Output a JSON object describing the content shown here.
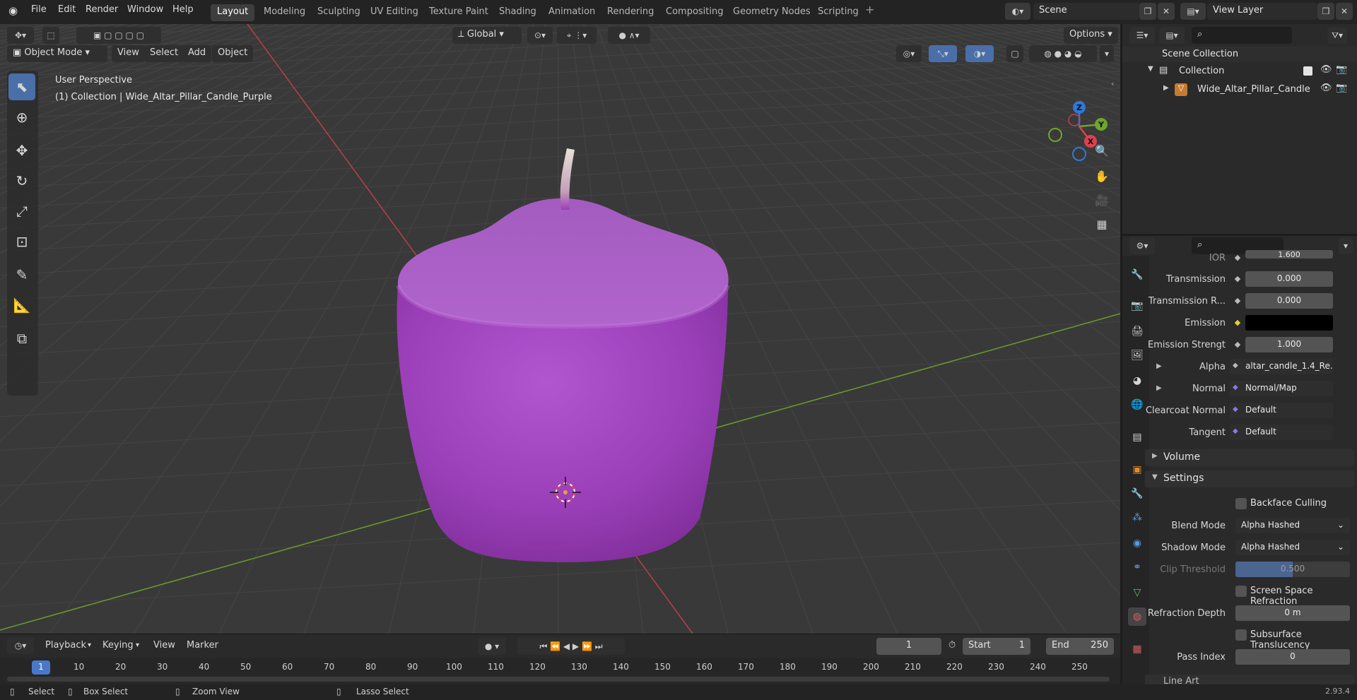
{
  "menu": {
    "items": [
      "File",
      "Edit",
      "Render",
      "Window",
      "Help"
    ]
  },
  "workspaces": {
    "tabs": [
      "Layout",
      "Modeling",
      "Sculpting",
      "UV Editing",
      "Texture Paint",
      "Shading",
      "Animation",
      "Rendering",
      "Compositing",
      "Geometry Nodes",
      "Scripting"
    ],
    "active": "Layout"
  },
  "scene": {
    "name": "Scene",
    "view_layer": "View Layer"
  },
  "viewport_header": {
    "mode": "Object Mode",
    "menus": [
      "View",
      "Select",
      "Add",
      "Object"
    ],
    "transform_orientation": "Global",
    "options_label": "Options"
  },
  "viewport": {
    "perspective_label": "User Perspective",
    "collection_label": "(1) Collection | Wide_Altar_Pillar_Candle_Purple",
    "gizmo_axes": [
      "Z",
      "Y",
      "X"
    ],
    "axis_colors": {
      "x": "#e0404f",
      "y": "#6ea52c",
      "z": "#2f78d8"
    },
    "object_color": "#9a3fb8"
  },
  "outliner": {
    "root": "Scene Collection",
    "collection": "Collection",
    "object": "Wide_Altar_Pillar_Candle"
  },
  "properties": {
    "rows": [
      {
        "label": "IOR",
        "value": "1.600"
      },
      {
        "label": "Transmission",
        "value": "0.000"
      },
      {
        "label": "Transmission R...",
        "value": "0.000"
      },
      {
        "label": "Emission",
        "value": ""
      },
      {
        "label": "Emission Strengt",
        "value": "1.000"
      }
    ],
    "links": [
      {
        "label": "Alpha",
        "value": "altar_candle_1.4_Re..."
      },
      {
        "label": "Normal",
        "value": "Normal/Map"
      },
      {
        "label": "Clearcoat Normal",
        "value": "Default"
      },
      {
        "label": "Tangent",
        "value": "Default"
      }
    ],
    "sections": [
      "Volume",
      "Settings",
      "Line Art"
    ],
    "backface_culling": "Backface Culling",
    "blend_mode": {
      "label": "Blend Mode",
      "value": "Alpha Hashed"
    },
    "shadow_mode": {
      "label": "Shadow Mode",
      "value": "Alpha Hashed"
    },
    "clip_threshold": {
      "label": "Clip Threshold",
      "value": "0.500"
    },
    "screen_space_refraction": "Screen Space Refraction",
    "refraction_depth": {
      "label": "Refraction Depth",
      "value": "0 m"
    },
    "subsurface_translucency": "Subsurface Translucency",
    "pass_index": {
      "label": "Pass Index",
      "value": "0"
    }
  },
  "timeline": {
    "menus": [
      "Playback",
      "Keying",
      "View",
      "Marker"
    ],
    "current_frame": "1",
    "start_label": "Start",
    "start": "1",
    "end_label": "End",
    "end": "250",
    "frame_ticks": [
      "1",
      "10",
      "20",
      "30",
      "40",
      "50",
      "60",
      "70",
      "80",
      "90",
      "100",
      "110",
      "120",
      "130",
      "140",
      "150",
      "160",
      "170",
      "180",
      "190",
      "200",
      "210",
      "220",
      "230",
      "240",
      "250"
    ]
  },
  "statusbar": {
    "select": "Select",
    "box_select": "Box Select",
    "zoom_view": "Zoom View",
    "lasso_select": "Lasso Select",
    "version": "2.93.4"
  }
}
